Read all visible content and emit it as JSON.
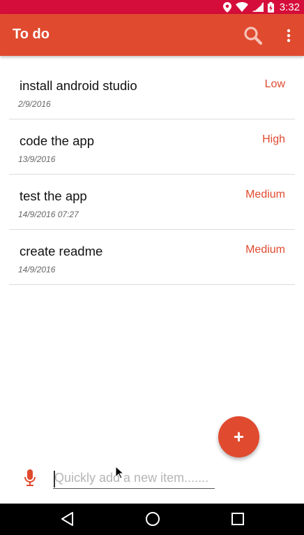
{
  "status_bar": {
    "time": "3:32",
    "icons": [
      "location-icon",
      "wifi-icon",
      "no-signal-icon",
      "battery-charging-icon"
    ]
  },
  "app_bar": {
    "title": "To do",
    "actions": [
      "search-icon",
      "more-vert-icon"
    ],
    "color": "#e04a2f"
  },
  "tasks": [
    {
      "title": "install android studio",
      "date": "2/9/2016",
      "priority": "Low"
    },
    {
      "title": "code the app",
      "date": "13/9/2016",
      "priority": "High"
    },
    {
      "title": "test the app",
      "date": "14/9/2016 07:27",
      "priority": "Medium"
    },
    {
      "title": "create readme",
      "date": "14/9/2016",
      "priority": "Medium"
    }
  ],
  "fab": {
    "icon": "plus-icon",
    "label": "+"
  },
  "quick_add": {
    "placeholder": "Quickly add a new item.......",
    "value": "",
    "icon": "mic-icon"
  },
  "nav_bar": {
    "buttons": [
      "back-icon",
      "home-icon",
      "recents-icon"
    ]
  }
}
